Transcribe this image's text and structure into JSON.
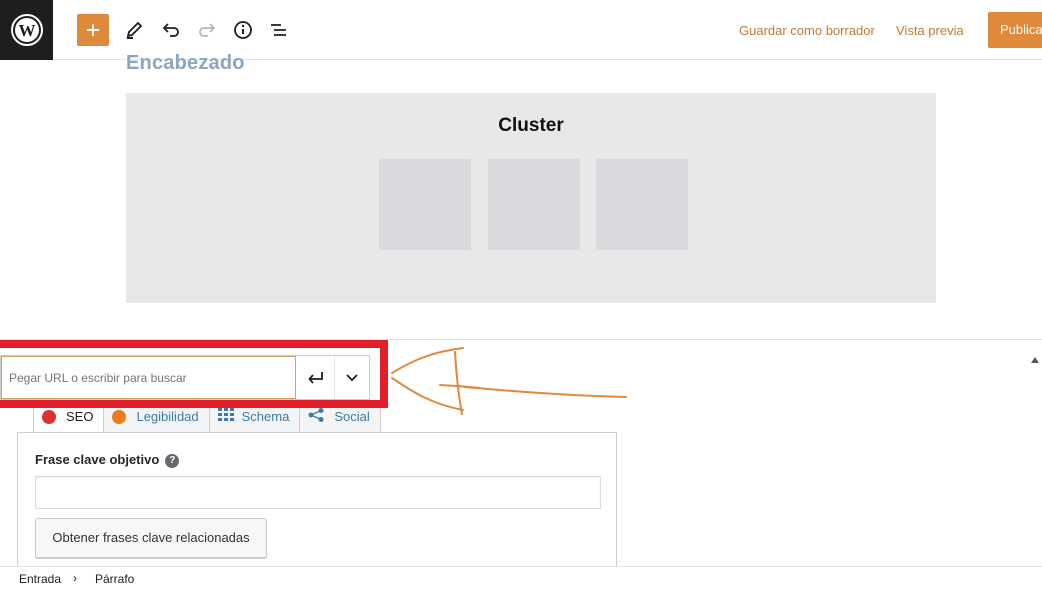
{
  "toolbar": {
    "save_draft": "Guardar como borrador",
    "preview": "Vista previa",
    "publish": "Publicar"
  },
  "content": {
    "heading": "Encabezado",
    "cluster_title": "Cluster"
  },
  "link_popover": {
    "placeholder": "Pegar URL o escribir para buscar"
  },
  "seo_tabs": [
    {
      "label": "SEO",
      "color": "#dc3232"
    },
    {
      "label": "Legibilidad",
      "color": "#ee7c1b"
    },
    {
      "label": "Schema",
      "color": "#3e7ba6"
    },
    {
      "label": "Social",
      "color": "#3e7ba6"
    }
  ],
  "seo_panel": {
    "focus_label": "Frase clave objetivo",
    "focus_value": "",
    "related_button": "Obtener frases clave relacionadas"
  },
  "breadcrumb": {
    "items": [
      "Entrada",
      "Párrafo"
    ]
  },
  "colors": {
    "accent": "#df8a3a",
    "highlight": "#e01f2a",
    "annotation": "#e0893c"
  }
}
